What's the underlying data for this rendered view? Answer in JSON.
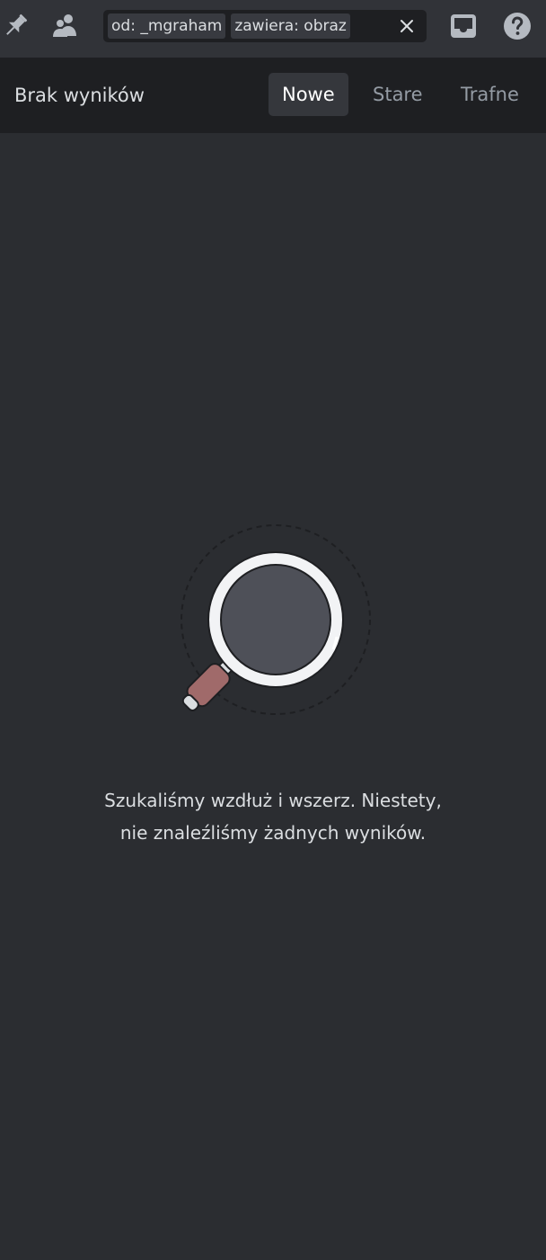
{
  "toolbar": {
    "pin_icon": "pin-icon",
    "members_icon": "members-icon",
    "inbox_icon": "inbox-icon",
    "help_icon": "help-icon"
  },
  "search": {
    "tokens": [
      {
        "label": "od: _mgraham"
      },
      {
        "label": "zawiera: obraz"
      }
    ],
    "clear_icon": "close-icon"
  },
  "results": {
    "status_label": "Brak wyników",
    "sort_tabs": [
      {
        "label": "Nowe",
        "active": true
      },
      {
        "label": "Stare",
        "active": false
      },
      {
        "label": "Trafne",
        "active": false
      }
    ]
  },
  "empty_state": {
    "illustration": "magnifying-glass-icon",
    "line1": "Szukaliśmy wzdłuż i wszerz. Niestety,",
    "line2": "nie znaleźliśmy żadnych wyników."
  },
  "colors": {
    "background": "#2b2d31",
    "topbar": "#313338",
    "subbar": "#1e1f22",
    "active_tab": "#35373c",
    "handle": "#a06a6a"
  }
}
